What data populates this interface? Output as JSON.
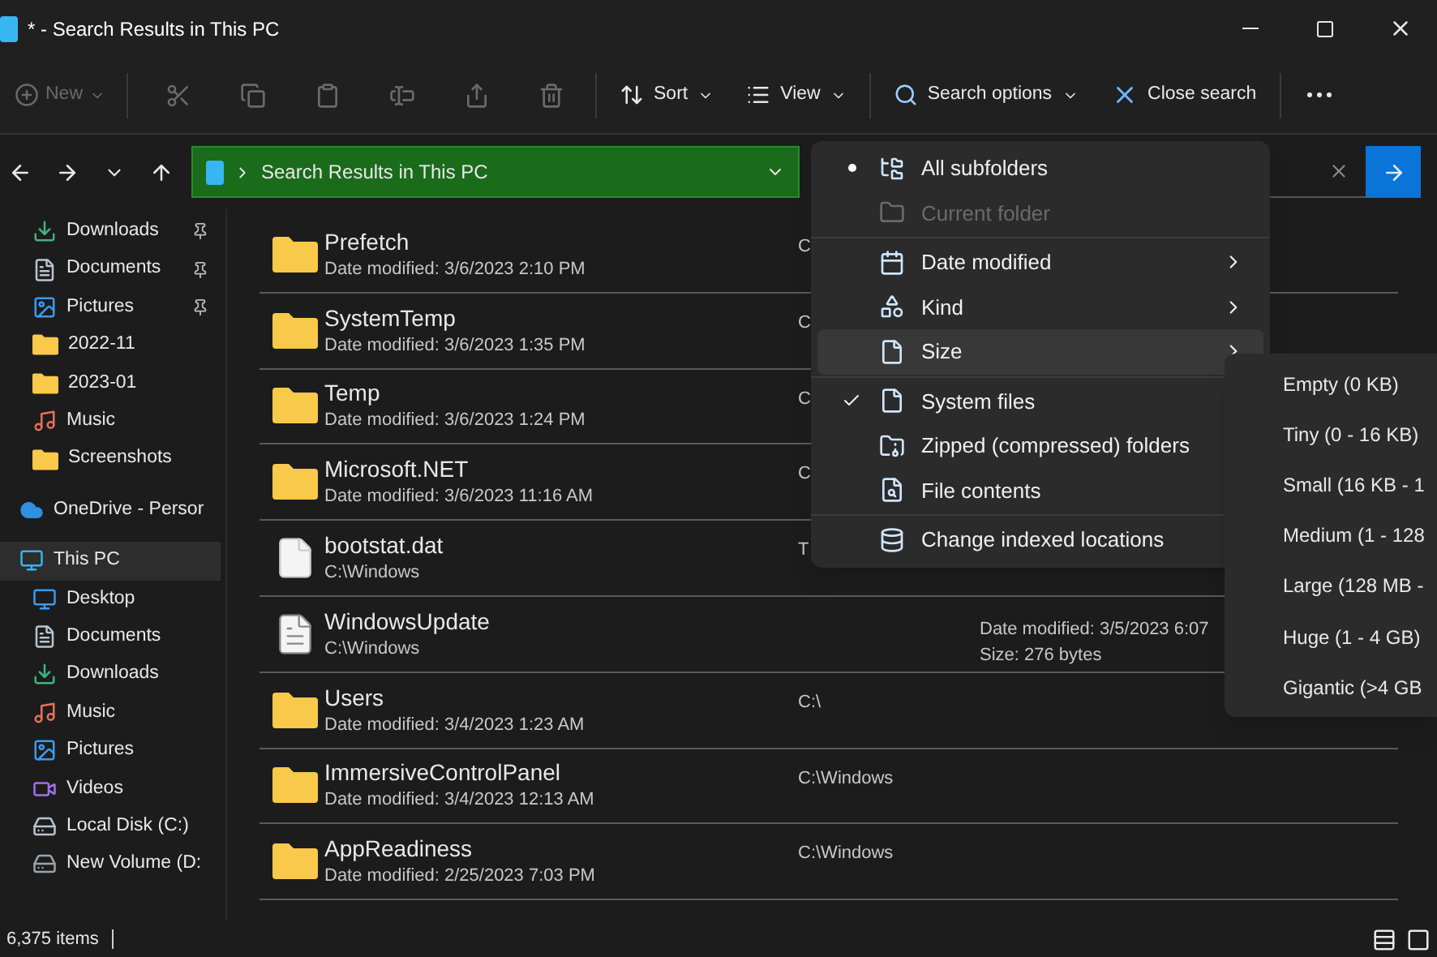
{
  "window": {
    "title": "* - Search Results in This PC"
  },
  "toolbar": {
    "new": {
      "label": "New",
      "disabled": true
    },
    "sort": {
      "label": "Sort"
    },
    "view": {
      "label": "View"
    },
    "search_options": {
      "label": "Search options"
    },
    "close_search": {
      "label": "Close search"
    }
  },
  "address": {
    "path": "Search Results in This PC"
  },
  "sidebar": {
    "quick_access": [
      {
        "label": "Downloads",
        "kind": "downloads",
        "pinned": true
      },
      {
        "label": "Documents",
        "kind": "documents",
        "pinned": true
      },
      {
        "label": "Pictures",
        "kind": "pictures",
        "pinned": true
      },
      {
        "label": "2022-11",
        "kind": "folder",
        "pinned": false
      },
      {
        "label": "2023-01",
        "kind": "folder",
        "pinned": false
      },
      {
        "label": "Music",
        "kind": "music",
        "pinned": false
      },
      {
        "label": "Screenshots",
        "kind": "folder",
        "pinned": false
      }
    ],
    "locations": [
      {
        "label": "OneDrive - Persor",
        "kind": "cloud",
        "selected": false
      },
      {
        "label": "This PC",
        "kind": "pc",
        "selected": true,
        "children": [
          {
            "label": "Desktop",
            "kind": "desktop",
            "selected": false
          },
          {
            "label": "Documents",
            "kind": "documents",
            "selected": false
          },
          {
            "label": "Downloads",
            "kind": "downloads",
            "selected": false
          },
          {
            "label": "Music",
            "kind": "music",
            "selected": false
          },
          {
            "label": "Pictures",
            "kind": "pictures",
            "selected": false
          },
          {
            "label": "Videos",
            "kind": "videos",
            "selected": false
          },
          {
            "label": "Local Disk (C:)",
            "kind": "disk",
            "selected": false
          },
          {
            "label": "New Volume (D:",
            "kind": "drive",
            "selected": false
          }
        ]
      }
    ]
  },
  "files": [
    {
      "name": "Prefetch",
      "kind": "folder",
      "detail": "Date modified: 3/6/2023 2:10 PM",
      "column_3": "C"
    },
    {
      "name": "SystemTemp",
      "kind": "folder",
      "detail": "Date modified: 3/6/2023 1:35 PM",
      "column_3": "C"
    },
    {
      "name": "Temp",
      "kind": "folder",
      "detail": "Date modified: 3/6/2023 1:24 PM",
      "column_3": "C"
    },
    {
      "name": "Microsoft.NET",
      "kind": "folder",
      "detail": "Date modified: 3/6/2023 11:16 AM",
      "column_3": "C"
    },
    {
      "name": "bootstat.dat",
      "kind": "file",
      "detail": "C:\\Windows",
      "column_3": "T"
    },
    {
      "name": "WindowsUpdate",
      "kind": "text",
      "detail": "C:\\Windows",
      "column_4": [
        "Date modified: 3/5/2023 6:07",
        "Size: 276 bytes"
      ]
    },
    {
      "name": "Users",
      "kind": "folder",
      "detail": "Date modified: 3/4/2023 1:23 AM",
      "column_3": "C:\\"
    },
    {
      "name": "ImmersiveControlPanel",
      "kind": "folder",
      "detail": "Date modified: 3/4/2023 12:13 AM",
      "column_3": "C:\\Windows"
    },
    {
      "name": "AppReadiness",
      "kind": "folder",
      "detail": "Date modified: 2/25/2023 7:03 PM",
      "column_3": "C:\\Windows"
    }
  ],
  "search_menu": {
    "groups": [
      [
        {
          "label": "All subfolders",
          "kind": "radio",
          "selected": true,
          "disabled": false,
          "highlighted": false
        },
        {
          "label": "Current folder",
          "kind": "radio",
          "selected": false,
          "disabled": true,
          "highlighted": false
        }
      ],
      [
        {
          "label": "Date modified",
          "kind": "submenu",
          "disabled": false,
          "highlighted": false
        },
        {
          "label": "Kind",
          "kind": "submenu",
          "disabled": false,
          "highlighted": false
        },
        {
          "label": "Size",
          "kind": "submenu",
          "disabled": false,
          "highlighted": true
        }
      ],
      [
        {
          "label": "System files",
          "kind": "check",
          "checked": true,
          "disabled": false,
          "highlighted": false
        },
        {
          "label": "Zipped (compressed) folders",
          "kind": "check",
          "checked": false,
          "disabled": false,
          "highlighted": false
        },
        {
          "label": "File contents",
          "kind": "check",
          "checked": false,
          "disabled": false,
          "highlighted": false
        }
      ],
      [
        {
          "label": "Change indexed locations",
          "kind": "action",
          "disabled": false,
          "highlighted": false
        }
      ]
    ]
  },
  "size_submenu": {
    "items": [
      "Empty (0 KB)",
      "Tiny (0 - 16 KB)",
      "Small (16 KB - 1",
      "Medium (1 - 128",
      "Large (128 MB -",
      "Huge (1 - 4 GB)",
      "Gigantic (>4 GB"
    ]
  },
  "status_bar": {
    "count": "6,375 items"
  }
}
